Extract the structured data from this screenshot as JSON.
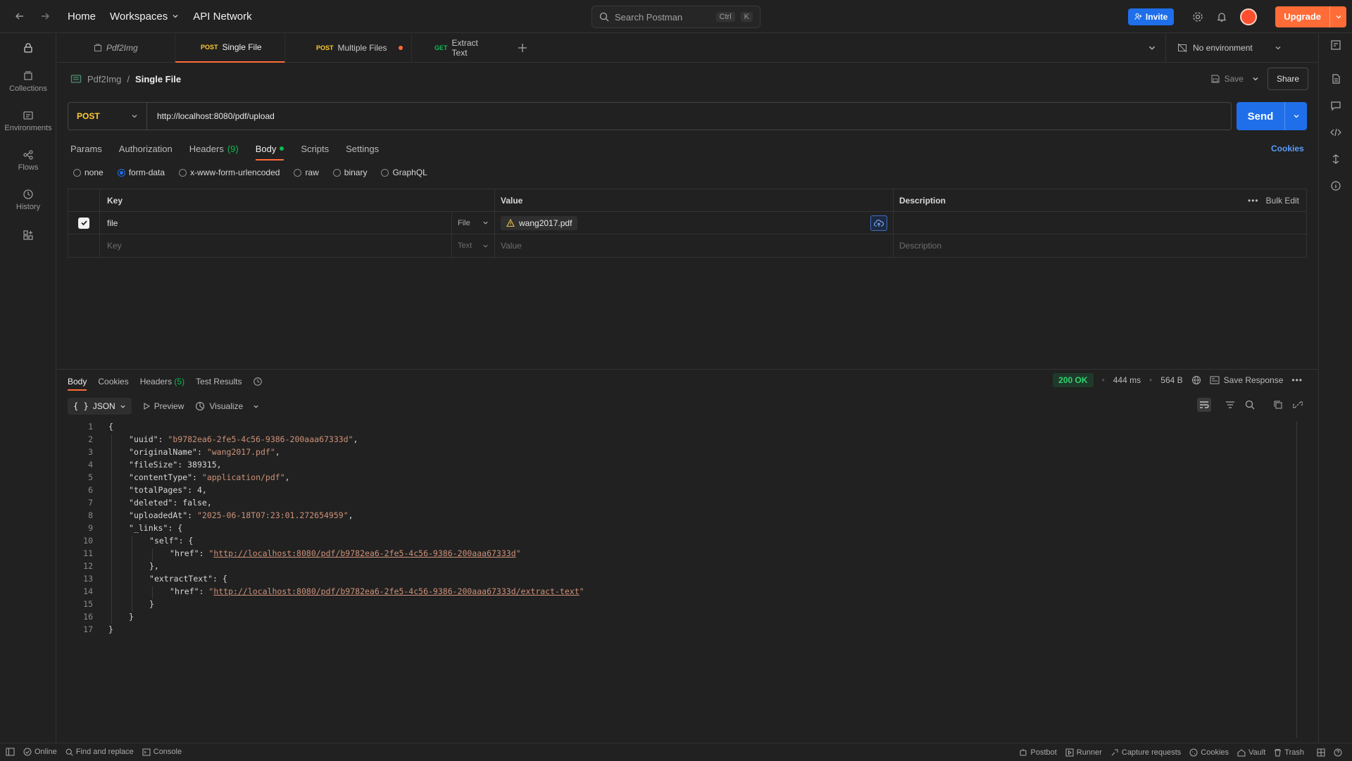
{
  "topbar": {
    "home": "Home",
    "workspaces": "Workspaces",
    "api_network": "API Network",
    "search_placeholder": "Search Postman",
    "search_kbd_1": "Ctrl",
    "search_kbd_2": "K",
    "invite": "Invite",
    "upgrade": "Upgrade"
  },
  "sidebar": {
    "items": [
      {
        "label": "Collections",
        "icon": "collections-icon"
      },
      {
        "label": "Environments",
        "icon": "environments-icon"
      },
      {
        "label": "Flows",
        "icon": "flows-icon"
      },
      {
        "label": "History",
        "icon": "history-icon"
      }
    ]
  },
  "tabs": [
    {
      "method": "",
      "label": "Pdf2Img",
      "italic": true
    },
    {
      "method": "POST",
      "label": "Single File",
      "active": true
    },
    {
      "method": "POST",
      "label": "Multiple Files",
      "unsaved": true
    },
    {
      "method": "GET",
      "label": "Extract Text"
    }
  ],
  "environment": {
    "label": "No environment"
  },
  "breadcrumb": {
    "collection": "Pdf2Img",
    "separator": "/",
    "request": "Single File"
  },
  "request_actions": {
    "save": "Save",
    "share": "Share"
  },
  "request": {
    "method": "POST",
    "url": "http://localhost:8080/pdf/upload",
    "send": "Send"
  },
  "request_tabs": {
    "params": "Params",
    "authorization": "Authorization",
    "headers": "Headers",
    "headers_count": "(9)",
    "body": "Body",
    "scripts": "Scripts",
    "settings": "Settings",
    "cookies": "Cookies"
  },
  "body_types": {
    "none": "none",
    "form_data": "form-data",
    "urlencoded": "x-www-form-urlencoded",
    "raw": "raw",
    "binary": "binary",
    "graphql": "GraphQL",
    "selected": "form-data"
  },
  "kv_table": {
    "headers": {
      "key": "Key",
      "value": "Value",
      "description": "Description",
      "bulk_edit": "Bulk Edit"
    },
    "rows": [
      {
        "key": "file",
        "type": "File",
        "value": "wang2017.pdf",
        "checked": true
      }
    ],
    "placeholder": {
      "key": "Key",
      "type": "Text",
      "value": "Value",
      "description": "Description"
    }
  },
  "response_tabs": {
    "body": "Body",
    "cookies": "Cookies",
    "headers": "Headers",
    "headers_count": "(5)",
    "test_results": "Test Results"
  },
  "response_status": {
    "status": "200 OK",
    "time": "444 ms",
    "size": "564 B",
    "save_response": "Save Response"
  },
  "response_tools": {
    "format": "JSON",
    "preview": "Preview",
    "visualize": "Visualize"
  },
  "response_body": {
    "lines": [
      {
        "n": "1",
        "text": "{"
      },
      {
        "n": "2",
        "key": "uuid",
        "str": "b9782ea6-2fe5-4c56-9386-200aaa67333d",
        "indent": 1
      },
      {
        "n": "3",
        "key": "originalName",
        "str": "wang2017.pdf",
        "indent": 1
      },
      {
        "n": "4",
        "key": "fileSize",
        "num": "389315",
        "indent": 1
      },
      {
        "n": "5",
        "key": "contentType",
        "str": "application/pdf",
        "indent": 1
      },
      {
        "n": "6",
        "key": "totalPages",
        "num": "4",
        "indent": 1
      },
      {
        "n": "7",
        "key": "deleted",
        "num": "false",
        "indent": 1
      },
      {
        "n": "8",
        "key": "uploadedAt",
        "str": "2025-06-18T07:23:01.272654959",
        "indent": 1
      },
      {
        "n": "9",
        "key": "_links",
        "open": "{",
        "indent": 1
      },
      {
        "n": "10",
        "key": "self",
        "open": "{",
        "indent": 2
      },
      {
        "n": "11",
        "key": "href",
        "link": "http://localhost:8080/pdf/b9782ea6-2fe5-4c56-9386-200aaa67333d",
        "indent": 3,
        "last": true
      },
      {
        "n": "12",
        "text": "},",
        "indent": 2
      },
      {
        "n": "13",
        "key": "extractText",
        "open": "{",
        "indent": 2
      },
      {
        "n": "14",
        "key": "href",
        "link": "http://localhost:8080/pdf/b9782ea6-2fe5-4c56-9386-200aaa67333d/extract-text",
        "indent": 3,
        "last": true
      },
      {
        "n": "15",
        "text": "}",
        "indent": 2
      },
      {
        "n": "16",
        "text": "}",
        "indent": 1
      },
      {
        "n": "17",
        "text": "}"
      }
    ]
  },
  "statusbar": {
    "online": "Online",
    "find_replace": "Find and replace",
    "console": "Console",
    "postbot": "Postbot",
    "runner": "Runner",
    "capture": "Capture requests",
    "cookies": "Cookies",
    "vault": "Vault",
    "trash": "Trash"
  },
  "colors": {
    "accent": "#ff6c37",
    "primary": "#1f6feb",
    "post_method": "#ffcb2e",
    "get_method": "#0cbb52",
    "status_ok": "#2fd46d"
  }
}
